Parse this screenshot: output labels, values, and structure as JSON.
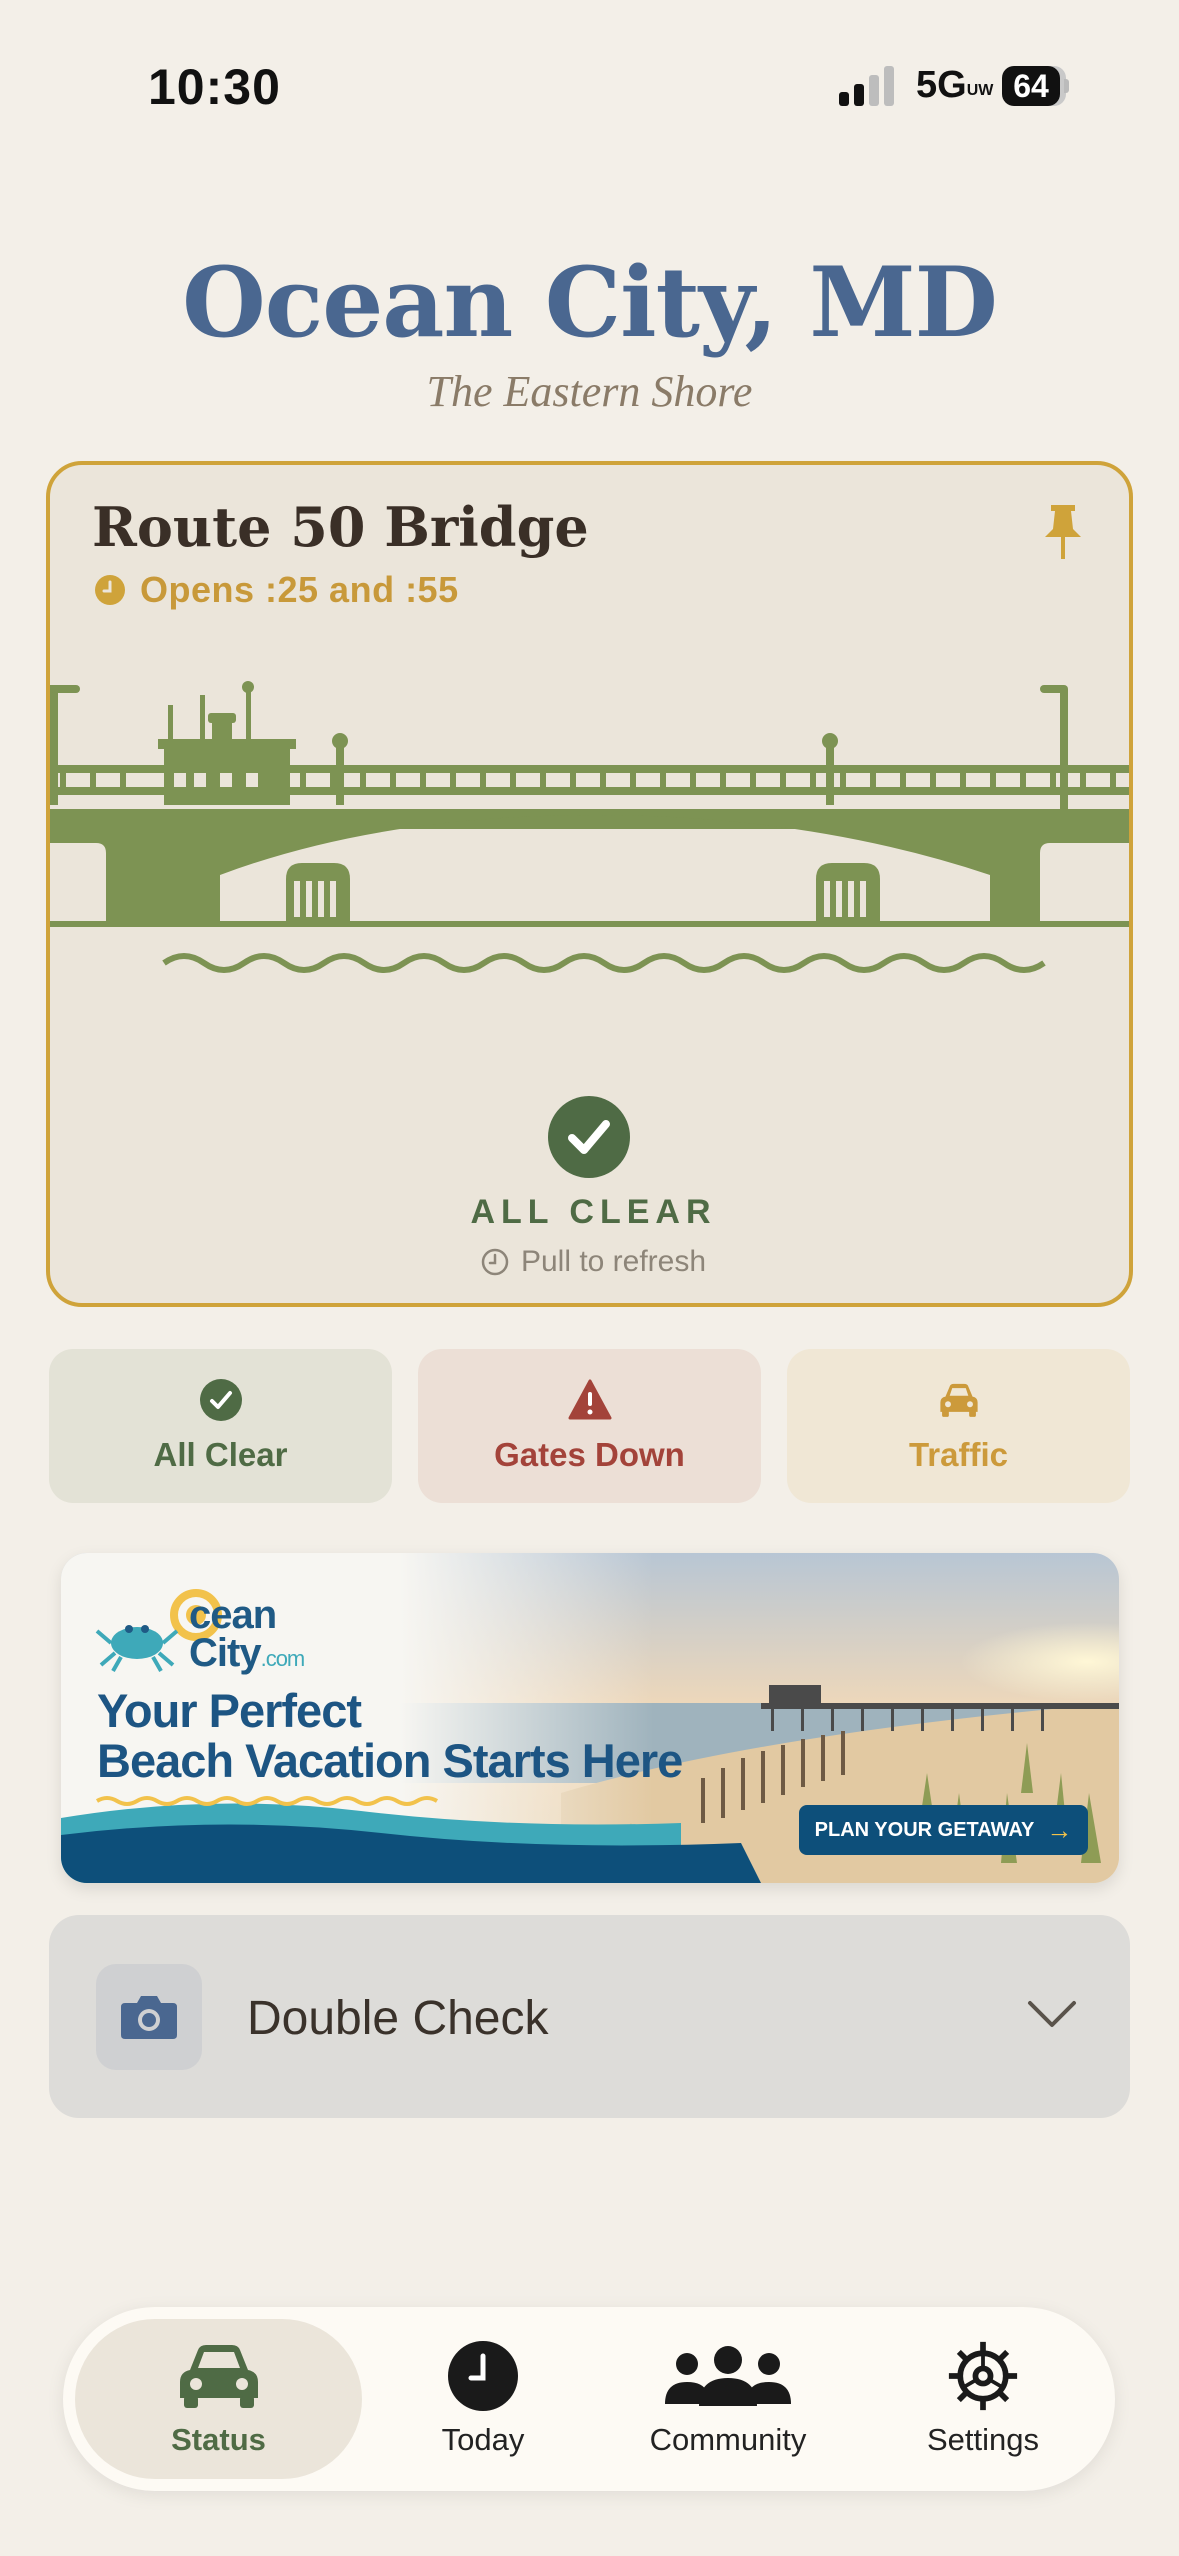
{
  "status_bar": {
    "time": "10:30",
    "network": "5G",
    "network_suffix": "UW",
    "battery": "64"
  },
  "header": {
    "title": "Ocean City, MD",
    "subtitle": "The Eastern Shore"
  },
  "bridge": {
    "name": "Route 50 Bridge",
    "schedule": "Opens :25 and :55",
    "status": "ALL CLEAR",
    "refresh_hint": "Pull to refresh"
  },
  "legend": [
    {
      "label": "All Clear",
      "icon": "check-circle-icon"
    },
    {
      "label": "Gates Down",
      "icon": "warning-icon"
    },
    {
      "label": "Traffic",
      "icon": "car-icon"
    }
  ],
  "ad": {
    "brand_line1": "cean",
    "brand_line2": "City",
    "brand_domain": ".com",
    "headline1": "Your Perfect",
    "headline2": "Beach Vacation Starts Here",
    "cta": "PLAN YOUR GETAWAY"
  },
  "double_check": {
    "label": "Double Check"
  },
  "tabs": [
    {
      "label": "Status",
      "icon": "car-icon",
      "selected": true
    },
    {
      "label": "Today",
      "icon": "clock-icon"
    },
    {
      "label": "Community",
      "icon": "people-icon"
    },
    {
      "label": "Settings",
      "icon": "gear-icon"
    }
  ],
  "colors": {
    "background": "#f3efe8",
    "title_blue": "#4a6790",
    "accent_gold": "#cfa33a",
    "clear_green": "#4f6b45",
    "bridge_green": "#7d9353",
    "gates_red": "#a3433a",
    "traffic_gold": "#cc9a3b"
  }
}
